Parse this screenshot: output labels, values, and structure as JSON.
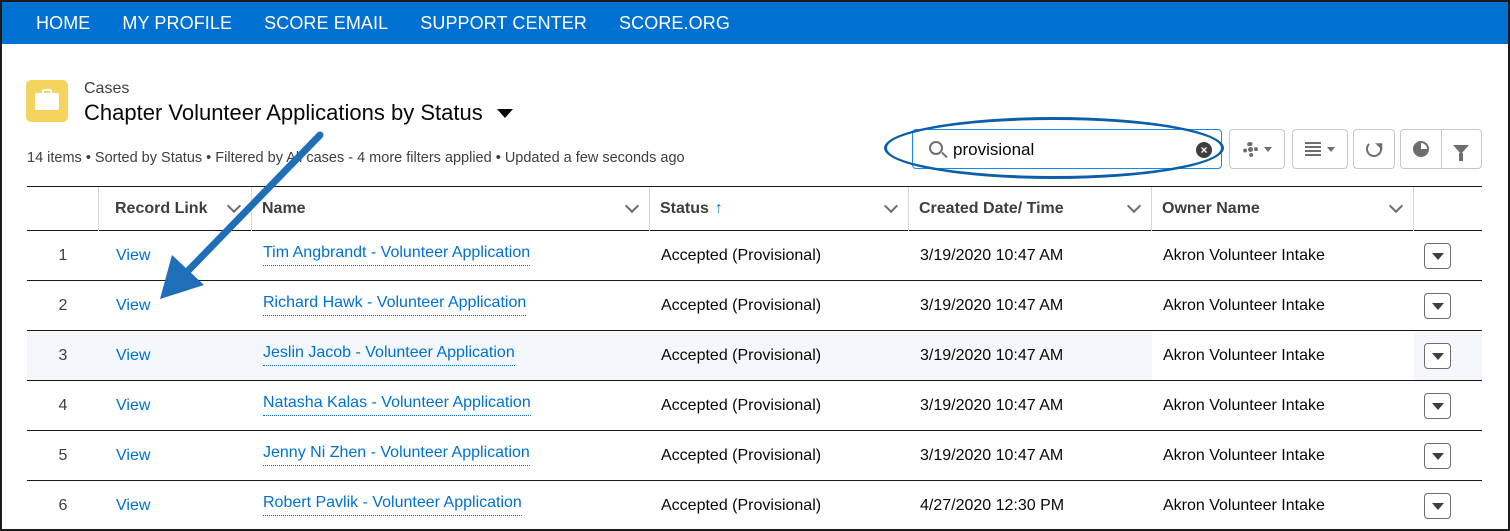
{
  "nav": {
    "items": [
      "HOME",
      "MY PROFILE",
      "SCORE EMAIL",
      "SUPPORT CENTER",
      "SCORE.ORG"
    ]
  },
  "header": {
    "object_label": "Cases",
    "list_title": "Chapter Volunteer Applications by Status",
    "meta": "14 items • Sorted by Status • Filtered by All cases - 4 more filters applied • Updated a few seconds ago"
  },
  "search": {
    "value": "provisional"
  },
  "toolbar_icons": [
    "gear-icon",
    "table-icon",
    "refresh-icon",
    "pie-chart-icon",
    "filter-icon"
  ],
  "table": {
    "columns": [
      "Record Link",
      "Name",
      "Status",
      "Created Date/ Time",
      "Owner Name"
    ],
    "sort_indicator": "↑",
    "rows": [
      {
        "num": "1",
        "link": "View",
        "name": "Tim Angbrandt - Volunteer Application",
        "status": "Accepted (Provisional)",
        "created": "3/19/2020 10:47 AM",
        "owner": "Akron Volunteer Intake"
      },
      {
        "num": "2",
        "link": "View",
        "name": "Richard Hawk - Volunteer Application",
        "status": "Accepted (Provisional)",
        "created": "3/19/2020 10:47 AM",
        "owner": "Akron Volunteer Intake"
      },
      {
        "num": "3",
        "link": "View",
        "name": "Jeslin Jacob - Volunteer Application",
        "status": "Accepted (Provisional)",
        "created": "3/19/2020 10:47 AM",
        "owner": "Akron Volunteer Intake"
      },
      {
        "num": "4",
        "link": "View",
        "name": "Natasha Kalas - Volunteer Application",
        "status": "Accepted (Provisional)",
        "created": "3/19/2020 10:47 AM",
        "owner": "Akron Volunteer Intake"
      },
      {
        "num": "5",
        "link": "View",
        "name": "Jenny Ni Zhen - Volunteer Application",
        "status": "Accepted (Provisional)",
        "created": "3/19/2020 10:47 AM",
        "owner": "Akron Volunteer Intake"
      },
      {
        "num": "6",
        "link": "View",
        "name": "Robert Pavlik - Volunteer Application",
        "status": "Accepted (Provisional)",
        "created": "4/27/2020 12:30 PM",
        "owner": "Akron Volunteer Intake"
      }
    ]
  },
  "colors": {
    "nav_bg": "#0070d2",
    "link": "#0070d2",
    "object_icon": "#f4d35e",
    "annotation": "#0a5fa8"
  }
}
